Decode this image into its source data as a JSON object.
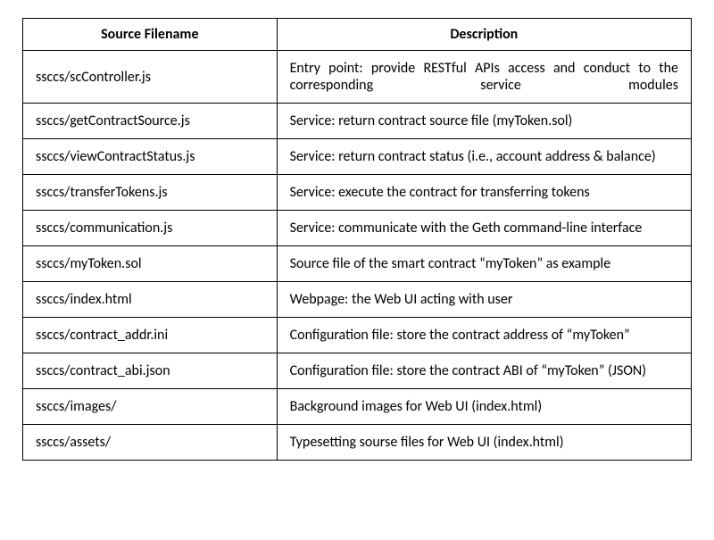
{
  "table": {
    "headers": {
      "filename": "Source Filename",
      "description": "Description"
    },
    "rows": [
      {
        "filename": "ssccs/scController.js",
        "description": "Entry point: provide RESTful APIs access and conduct to the corresponding service modules"
      },
      {
        "filename": "ssccs/getContractSource.js",
        "description": "Service: return contract source file (myToken.sol)"
      },
      {
        "filename": "ssccs/viewContractStatus.js",
        "description": "Service: return contract status (i.e., account address & balance)"
      },
      {
        "filename": "ssccs/transferTokens.js",
        "description": "Service: execute the contract for transferring tokens"
      },
      {
        "filename": "ssccs/communication.js",
        "description": "Service: communicate with the Geth command-line interface"
      },
      {
        "filename": "ssccs/myToken.sol",
        "description": "Source file of the smart contract “myToken” as example"
      },
      {
        "filename": "ssccs/index.html",
        "description": "Webpage: the Web UI acting with user"
      },
      {
        "filename": "ssccs/contract_addr.ini",
        "description": "Configuration file: store the contract address of “myToken”"
      },
      {
        "filename": "ssccs/contract_abi.json",
        "description": "Configuration file: store the contract ABI of “myToken” (JSON)"
      },
      {
        "filename": "ssccs/images/",
        "description": "Background images for Web UI (index.html)"
      },
      {
        "filename": "ssccs/assets/",
        "description": "Typesetting sourse files for Web UI (index.html)"
      }
    ]
  }
}
